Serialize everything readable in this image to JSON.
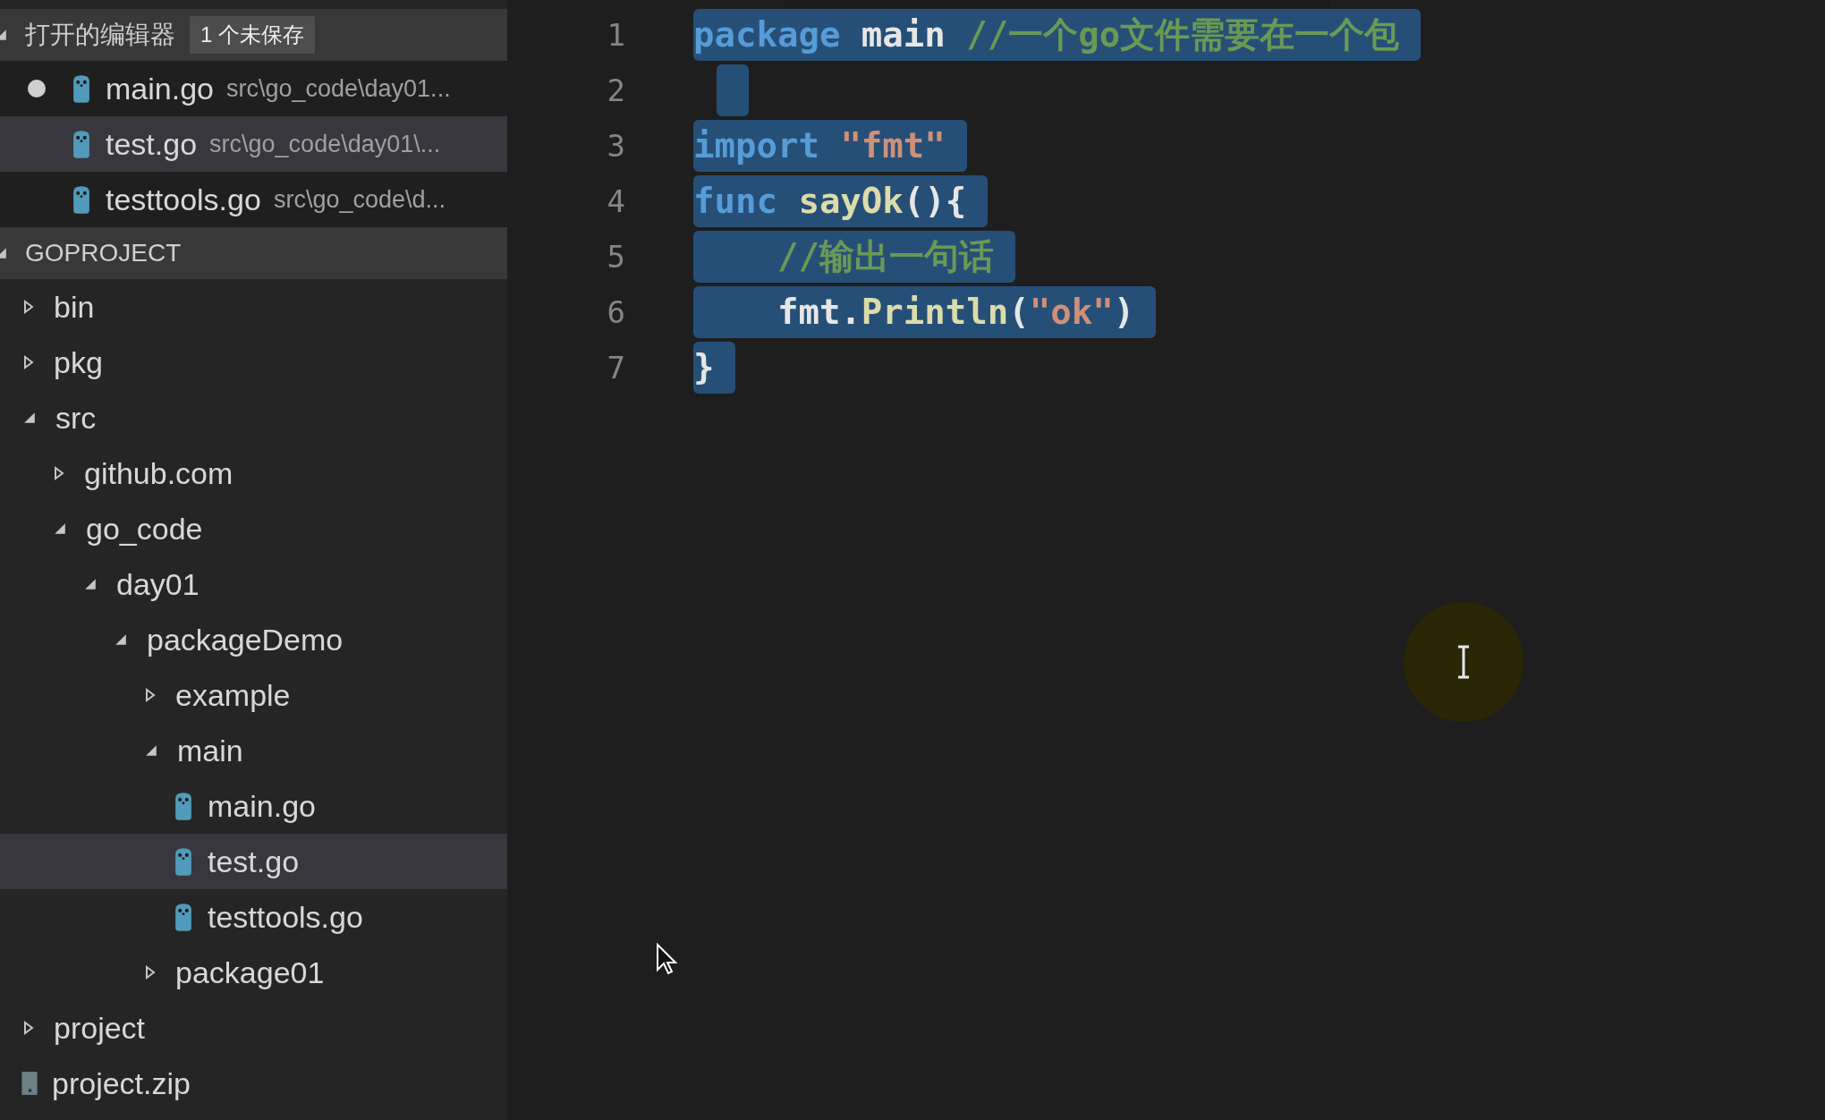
{
  "sidebar": {
    "open_editors": {
      "title": "打开的编辑器",
      "expanded": true,
      "badge": "1 个未保存",
      "items": [
        {
          "name": "main.go",
          "path": "src\\go_code\\day01...",
          "dirty": true,
          "selected": false
        },
        {
          "name": "test.go",
          "path": "src\\go_code\\day01\\...",
          "dirty": false,
          "selected": true
        },
        {
          "name": "testtools.go",
          "path": "src\\go_code\\d...",
          "dirty": false,
          "selected": false
        }
      ]
    },
    "explorer": {
      "title": "GOPROJECT",
      "expanded": true,
      "tree": [
        {
          "label": "bin",
          "kind": "folder",
          "expanded": false,
          "selected": false
        },
        {
          "label": "pkg",
          "kind": "folder",
          "expanded": false,
          "selected": false
        },
        {
          "label": "src",
          "kind": "folder",
          "expanded": true,
          "selected": false,
          "children": [
            {
              "label": "github.com",
              "kind": "folder",
              "expanded": false,
              "selected": false
            },
            {
              "label": "go_code",
              "kind": "folder",
              "expanded": true,
              "selected": false,
              "children": [
                {
                  "label": "day01",
                  "kind": "folder",
                  "expanded": true,
                  "selected": false,
                  "children": [
                    {
                      "label": "packageDemo",
                      "kind": "folder",
                      "expanded": true,
                      "selected": false,
                      "children": [
                        {
                          "label": "example",
                          "kind": "folder",
                          "expanded": false,
                          "selected": false
                        },
                        {
                          "label": "main",
                          "kind": "folder",
                          "expanded": true,
                          "selected": false,
                          "children": [
                            {
                              "label": "main.go",
                              "kind": "go",
                              "selected": false
                            },
                            {
                              "label": "test.go",
                              "kind": "go",
                              "selected": true
                            },
                            {
                              "label": "testtools.go",
                              "kind": "go",
                              "selected": false
                            }
                          ]
                        },
                        {
                          "label": "package01",
                          "kind": "folder",
                          "expanded": false,
                          "selected": false
                        }
                      ]
                    }
                  ]
                }
              ]
            }
          ]
        },
        {
          "label": "project",
          "kind": "folder",
          "expanded": false,
          "selected": false
        },
        {
          "label": "project.zip",
          "kind": "zip",
          "selected": false
        }
      ]
    }
  },
  "editor": {
    "lines": [
      {
        "number": "1",
        "selected": true,
        "tokens": [
          {
            "kind": "keyword",
            "text": "package"
          },
          {
            "kind": "plain",
            "text": " main "
          },
          {
            "kind": "comment",
            "text": "//一个go文件需要在一个包"
          }
        ]
      },
      {
        "number": "2",
        "selected": true
      },
      {
        "number": "3",
        "selected": true,
        "tokens": [
          {
            "kind": "keyword",
            "text": "import "
          },
          {
            "kind": "string",
            "text": "\"fmt\""
          }
        ]
      },
      {
        "number": "4",
        "selected": true,
        "tokens": [
          {
            "kind": "keyword",
            "text": "func "
          },
          {
            "kind": "function",
            "text": "sayOk"
          },
          {
            "kind": "plain",
            "text": "(){"
          }
        ]
      },
      {
        "number": "5",
        "selected": true,
        "tokens": [
          {
            "kind": "comment",
            "text": "    //输出一句话"
          }
        ]
      },
      {
        "number": "6",
        "selected": true,
        "tokens": [
          {
            "kind": "plain",
            "text": "    fmt."
          },
          {
            "kind": "function",
            "text": "Println"
          },
          {
            "kind": "plain",
            "text": "("
          },
          {
            "kind": "string",
            "text": "\"ok\""
          },
          {
            "kind": "plain",
            "text": ")"
          }
        ]
      },
      {
        "number": "7",
        "selected": true,
        "tokens": [
          {
            "kind": "plain",
            "text": "}"
          }
        ]
      }
    ]
  }
}
